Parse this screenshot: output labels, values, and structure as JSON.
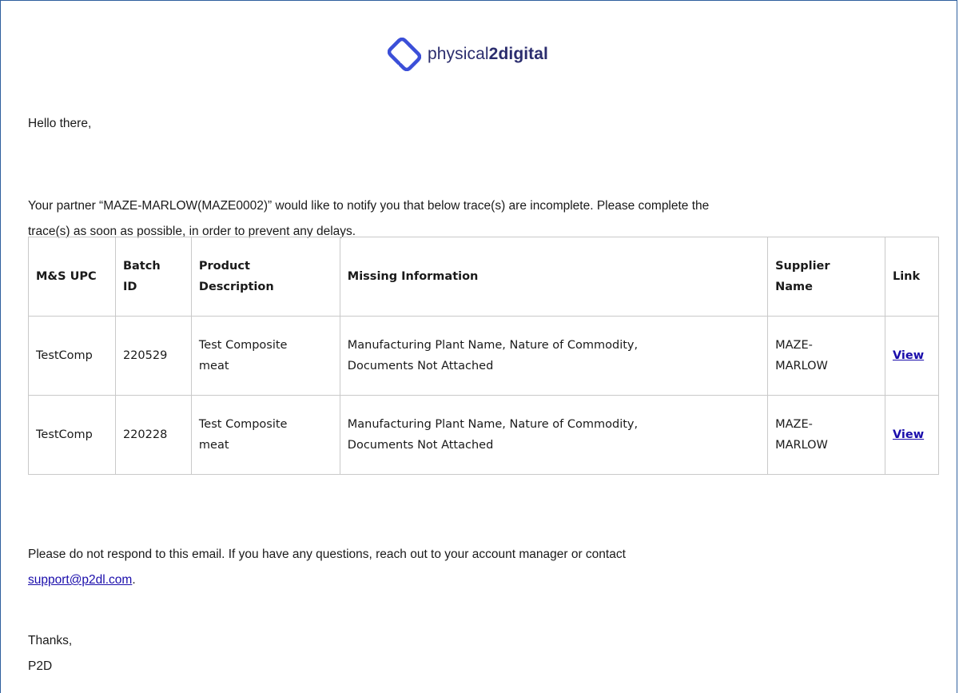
{
  "brand": {
    "name_regular": "physical",
    "name_bold": "2digital",
    "color": "#2b2d6e",
    "accent": "#3b4fd8"
  },
  "greeting": "Hello there,",
  "intro": {
    "line1": "Your partner “MAZE-MARLOW(MAZE0002)” would like to notify you that below trace(s) are incomplete. Please complete the",
    "line2": "trace(s) as soon as possible, in order to prevent any delays."
  },
  "table": {
    "headers": {
      "upc": "M&S UPC",
      "batch": [
        "Batch",
        "ID"
      ],
      "product": [
        "Product",
        "Description"
      ],
      "missing": "Missing Information",
      "supplier": [
        "Supplier",
        "Name"
      ],
      "link": "Link"
    },
    "rows": [
      {
        "upc": "TestComp",
        "batch": "220529",
        "product": [
          "Test Composite",
          "meat"
        ],
        "missing": [
          "Manufacturing Plant Name, Nature of Commodity,",
          "Documents Not Attached"
        ],
        "supplier": [
          "MAZE-",
          "MARLOW"
        ],
        "link": "View"
      },
      {
        "upc": "TestComp",
        "batch": "220228",
        "product": [
          "Test Composite",
          "meat"
        ],
        "missing": [
          "Manufacturing Plant Name, Nature of Commodity,",
          "Documents Not Attached"
        ],
        "supplier": [
          "MAZE-",
          "MARLOW"
        ],
        "link": "View"
      }
    ]
  },
  "footer": {
    "line1": "Please do not respond to this email. If you have any questions, reach out to your account manager or contact",
    "email": "support@p2dl.com",
    "after_email": "."
  },
  "sign": {
    "thanks": "Thanks,",
    "name": "P2D"
  }
}
